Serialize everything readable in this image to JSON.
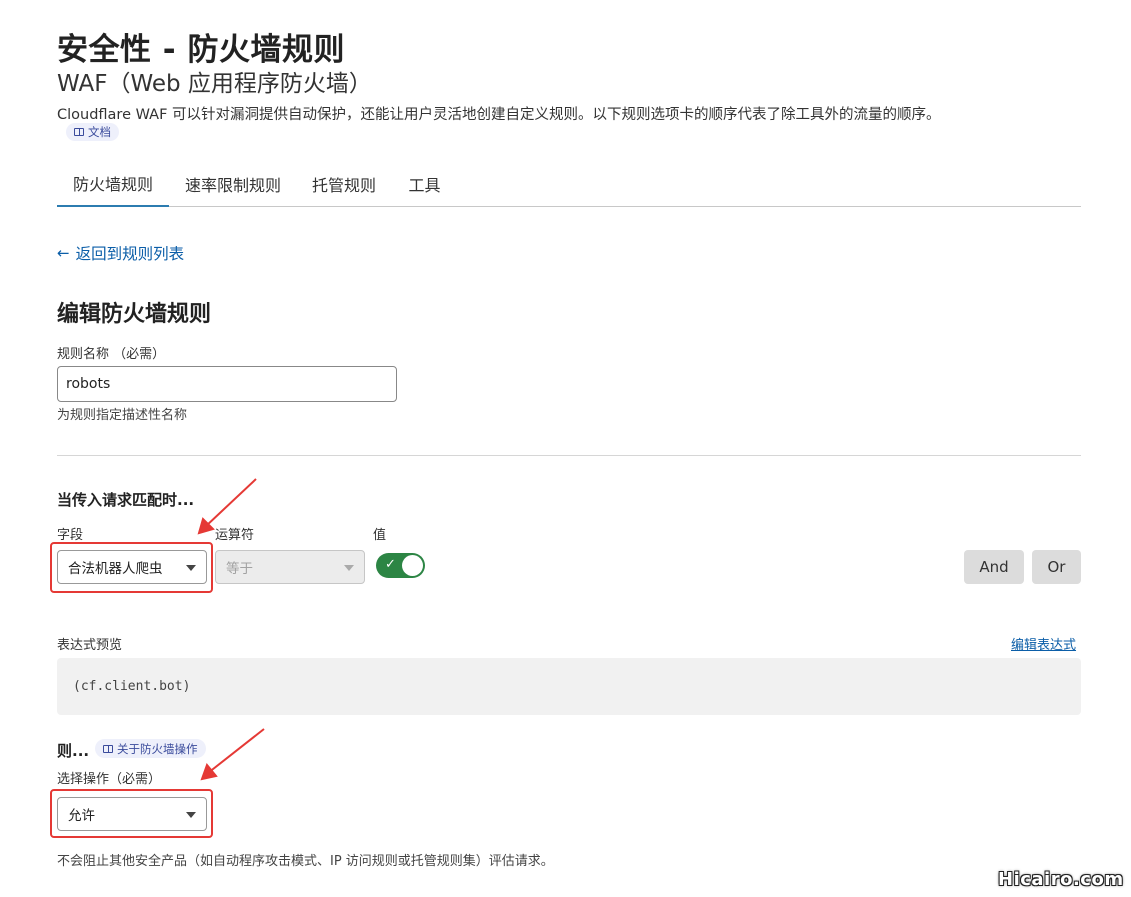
{
  "header": {
    "title": "安全性 - 防火墙规则",
    "subtitle": "WAF（Web 应用程序防火墙）",
    "description": "Cloudflare WAF 可以针对漏洞提供自动保护，还能让用户灵活地创建自定义规则。以下规则选项卡的顺序代表了除工具外的流量的顺序。",
    "doc_badge": "文档"
  },
  "tabs": [
    {
      "label": "防火墙规则",
      "active": true
    },
    {
      "label": "速率限制规则",
      "active": false
    },
    {
      "label": "托管规则",
      "active": false
    },
    {
      "label": "工具",
      "active": false
    }
  ],
  "back_link": "返回到规则列表",
  "form": {
    "title": "编辑防火墙规则",
    "rule_name_label": "规则名称 （必需）",
    "rule_name_value": "robots",
    "rule_name_helper": "为规则指定描述性名称"
  },
  "when": {
    "heading": "当传入请求匹配时...",
    "field_label": "字段",
    "field_value": "合法机器人爬虫",
    "operator_label": "运算符",
    "operator_value": "等于",
    "value_label": "值",
    "toggle_on": true,
    "and_label": "And",
    "or_label": "Or"
  },
  "expression": {
    "label": "表达式预览",
    "edit_link": "编辑表达式",
    "text": "(cf.client.bot)"
  },
  "then": {
    "heading": "则...",
    "about_badge": "关于防火墙操作",
    "action_label": "选择操作（必需）",
    "action_value": "允许",
    "action_note": "不会阻止其他安全产品（如自动程序攻击模式、IP 访问规则或托管规则集）评估请求。"
  },
  "colors": {
    "link": "#0b5ea8",
    "tab_underline": "#2c7cb0",
    "toggle_on": "#2c8544",
    "annotation_red": "#e53935"
  },
  "watermark": "Hicairo.com"
}
